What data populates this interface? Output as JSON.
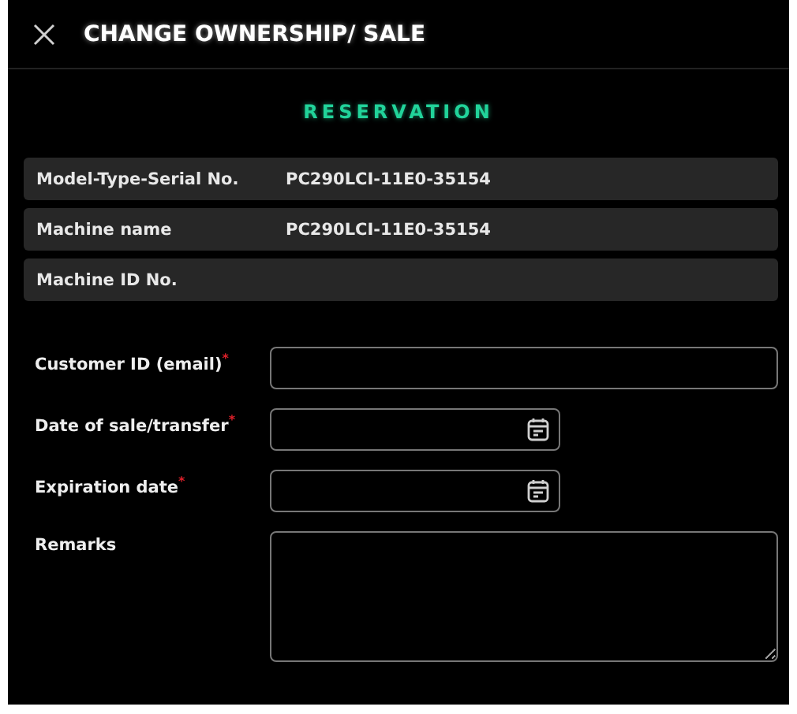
{
  "header": {
    "title": "CHANGE OWNERSHIP/ SALE"
  },
  "section_title": "RESERVATION",
  "info_rows": [
    {
      "label": "Model-Type-Serial No.",
      "value": "PC290LCI-11E0-35154"
    },
    {
      "label": "Machine name",
      "value": "PC290LCI-11E0-35154"
    },
    {
      "label": "Machine ID No."
    }
  ],
  "fields": [
    {
      "kind": "text",
      "label": "Customer ID (email)",
      "required_mark": "*"
    },
    {
      "kind": "date",
      "label": "Date of sale/transfer",
      "required_mark": "*"
    },
    {
      "kind": "date",
      "label": "Expiration date",
      "required_mark": "*"
    },
    {
      "kind": "textarea",
      "label": "Remarks"
    }
  ]
}
